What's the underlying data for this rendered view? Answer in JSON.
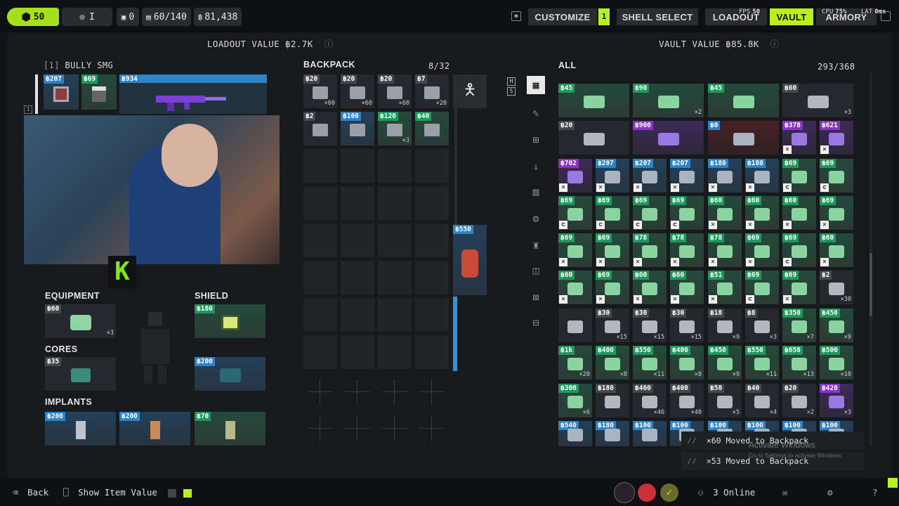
{
  "topbar": {
    "level": "50",
    "badge_i": "I",
    "shield_count": "0",
    "capacity": "60/140",
    "currency": "81,438",
    "nav": [
      "CUSTOMIZE",
      "SHELL SELECT",
      "LOADOUT",
      "VAULT",
      "ARMORY"
    ],
    "customize_count": "1",
    "stats": {
      "fps_label": "FPS",
      "fps": "50",
      "cpu_label": "CPU",
      "cpu": "75%",
      "lat_label": "LAT",
      "lat": "0ms"
    }
  },
  "loadout": {
    "value_label": "LOADOUT VALUE",
    "value": "2.7K",
    "weapon_slot": "[1]",
    "weapon_name": "BULLY SMG",
    "mods": [
      "207",
      "69",
      "934"
    ],
    "weapon_index": "1",
    "equipment_label": "EQUIPMENT",
    "equipment": {
      "price": "60",
      "qty": "×3"
    },
    "shield_label": "SHIELD",
    "shield": {
      "price": "180"
    },
    "cores_label": "CORES",
    "cores": {
      "price": "35"
    },
    "core2": {
      "price": "200"
    },
    "implants_label": "IMPLANTS",
    "implants": [
      "200",
      "200",
      "70"
    ]
  },
  "backpack": {
    "label": "BACKPACK",
    "count": "8/32",
    "items": [
      {
        "price": "20",
        "qty": "×60",
        "color": "gr"
      },
      {
        "price": "20",
        "qty": "×60",
        "color": "gr"
      },
      {
        "price": "20",
        "qty": "×60",
        "color": "gr"
      },
      {
        "price": "7",
        "qty": "×20",
        "color": "gr"
      },
      {
        "price": "2",
        "qty": "",
        "color": "gr"
      },
      {
        "price": "100",
        "qty": "",
        "color": "b"
      },
      {
        "price": "120",
        "qty": "×3",
        "color": "g"
      },
      {
        "price": "40",
        "qty": "",
        "color": "g"
      }
    ],
    "side_item_price": "550",
    "side_labels": [
      "H",
      "S"
    ]
  },
  "vault": {
    "value_label": "VAULT VALUE",
    "value": "85.8K",
    "category": "ALL",
    "count": "293/368",
    "rows": [
      [
        {
          "p": "45",
          "c": "g",
          "q": ""
        },
        {
          "p": "90",
          "c": "g",
          "q": "×2"
        },
        {
          "p": "45",
          "c": "g",
          "q": ""
        },
        {
          "p": "60",
          "c": "gr",
          "q": "×3"
        }
      ],
      [
        {
          "p": "20",
          "c": "gr",
          "q": ""
        },
        {
          "p": "900",
          "c": "p",
          "q": ""
        },
        {
          "p": "0",
          "c": "b",
          "q": ""
        },
        {
          "p": "378",
          "c": "p",
          "q": "",
          "x": 1
        },
        {
          "p": "621",
          "c": "p",
          "q": "",
          "x": 1
        }
      ],
      [
        {
          "p": "702",
          "c": "p",
          "q": "",
          "x": 1
        },
        {
          "p": "207",
          "c": "b",
          "q": "",
          "x": 1
        },
        {
          "p": "207",
          "c": "b",
          "q": "",
          "x": 1
        },
        {
          "p": "207",
          "c": "b",
          "q": "",
          "x": 1
        },
        {
          "p": "180",
          "c": "b",
          "q": "",
          "x": 1
        },
        {
          "p": "180",
          "c": "b",
          "q": "",
          "x": 1
        },
        {
          "p": "69",
          "c": "g",
          "q": "",
          "m": 1
        },
        {
          "p": "69",
          "c": "g",
          "q": "",
          "m": 1
        }
      ],
      [
        {
          "p": "69",
          "c": "g",
          "q": "",
          "m": 1
        },
        {
          "p": "69",
          "c": "g",
          "q": "",
          "m": 1
        },
        {
          "p": "69",
          "c": "g",
          "q": "",
          "m": 1
        },
        {
          "p": "69",
          "c": "g",
          "q": "",
          "m": 1
        },
        {
          "p": "60",
          "c": "g",
          "q": "",
          "x": 1
        },
        {
          "p": "60",
          "c": "g",
          "q": "",
          "x": 1
        },
        {
          "p": "60",
          "c": "g",
          "q": "",
          "x": 1
        },
        {
          "p": "69",
          "c": "g",
          "q": "",
          "x": 1
        }
      ],
      [
        {
          "p": "69",
          "c": "g",
          "q": "",
          "x": 1
        },
        {
          "p": "69",
          "c": "g",
          "q": "",
          "x": 1
        },
        {
          "p": "78",
          "c": "g",
          "q": "",
          "x": 1
        },
        {
          "p": "78",
          "c": "g",
          "q": "",
          "x": 1
        },
        {
          "p": "78",
          "c": "g",
          "q": "",
          "x": 1
        },
        {
          "p": "69",
          "c": "g",
          "q": "",
          "x": 1
        },
        {
          "p": "69",
          "c": "g",
          "q": "",
          "m": 1
        },
        {
          "p": "60",
          "c": "g",
          "q": "",
          "x": 1
        }
      ],
      [
        {
          "p": "60",
          "c": "g",
          "q": "",
          "x": 1
        },
        {
          "p": "69",
          "c": "g",
          "q": "",
          "x": 1
        },
        {
          "p": "60",
          "c": "g",
          "q": "",
          "x": 1
        },
        {
          "p": "60",
          "c": "g",
          "q": "",
          "x": 1
        },
        {
          "p": "51",
          "c": "g",
          "q": "",
          "x": 1
        },
        {
          "p": "69",
          "c": "g",
          "q": "",
          "m": 1
        },
        {
          "p": "69",
          "c": "g",
          "q": "",
          "x": 1
        },
        {
          "p": "2",
          "c": "gr",
          "q": "×30"
        }
      ],
      [
        {
          "p": "",
          "c": "gr",
          "q": ""
        },
        {
          "p": "30",
          "c": "gr",
          "q": "×15"
        },
        {
          "p": "30",
          "c": "gr",
          "q": "×15"
        },
        {
          "p": "30",
          "c": "gr",
          "q": "×15"
        },
        {
          "p": "18",
          "c": "gr",
          "q": "×9"
        },
        {
          "p": "8",
          "c": "gr",
          "q": "×3"
        },
        {
          "p": "350",
          "c": "g",
          "q": "×7"
        },
        {
          "p": "450",
          "c": "g",
          "q": "×9"
        }
      ],
      [
        {
          "p": "1k",
          "c": "g",
          "q": "×20"
        },
        {
          "p": "400",
          "c": "g",
          "q": "×8"
        },
        {
          "p": "550",
          "c": "g",
          "q": "×11"
        },
        {
          "p": "400",
          "c": "g",
          "q": "×8"
        },
        {
          "p": "450",
          "c": "g",
          "q": "×9"
        },
        {
          "p": "550",
          "c": "g",
          "q": "×11"
        },
        {
          "p": "650",
          "c": "g",
          "q": "×13"
        },
        {
          "p": "500",
          "c": "g",
          "q": "×10"
        }
      ],
      [
        {
          "p": "300",
          "c": "g",
          "q": "×6"
        },
        {
          "p": "180",
          "c": "gr",
          "q": ""
        },
        {
          "p": "460",
          "c": "gr",
          "q": "×46"
        },
        {
          "p": "400",
          "c": "gr",
          "q": "×40"
        },
        {
          "p": "50",
          "c": "gr",
          "q": "×5"
        },
        {
          "p": "40",
          "c": "gr",
          "q": "×4"
        },
        {
          "p": "20",
          "c": "gr",
          "q": "×2"
        },
        {
          "p": "420",
          "c": "p",
          "q": "×3"
        }
      ],
      [
        {
          "p": "540",
          "c": "b",
          "q": ""
        },
        {
          "p": "180",
          "c": "b",
          "q": ""
        },
        {
          "p": "100",
          "c": "b",
          "q": ""
        },
        {
          "p": "100",
          "c": "b",
          "q": ""
        },
        {
          "p": "100",
          "c": "b",
          "q": ""
        },
        {
          "p": "100",
          "c": "b",
          "q": ""
        },
        {
          "p": "100",
          "c": "b",
          "q": ""
        },
        {
          "p": "100",
          "c": "b",
          "q": ""
        }
      ]
    ]
  },
  "toasts": [
    "×60 Moved to Backpack",
    "×53 Moved to Backpack"
  ],
  "watermark": {
    "title": "Activate Windows",
    "sub": "Go to Settings to activate Windows."
  },
  "bottombar": {
    "back": "Back",
    "show_value": "Show Item Value",
    "online": "3 Online"
  }
}
